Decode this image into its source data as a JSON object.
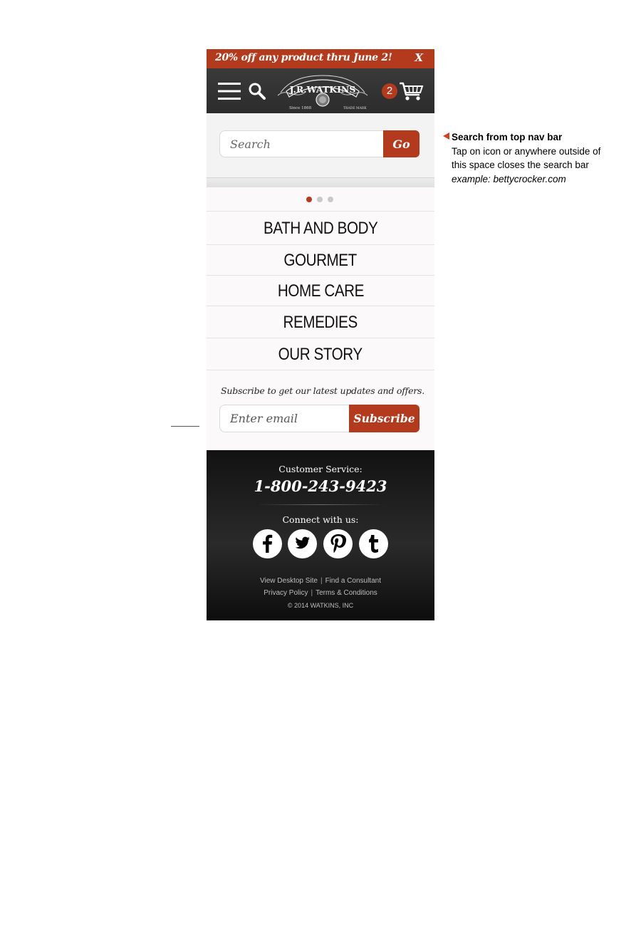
{
  "promo": {
    "text": "20% off any product thru June 2!",
    "close": "X"
  },
  "header": {
    "logo_name": "J.R.WATKINS",
    "logo_since": "Since 1868",
    "logo_trademark": "TRADE MARK",
    "cart_count": "2"
  },
  "search": {
    "placeholder": "Search",
    "button": "Go"
  },
  "carousel": {
    "dots": 3,
    "active_index": 0
  },
  "categories": [
    "BATH AND BODY",
    "GOURMET",
    "HOME CARE",
    "REMEDIES",
    "OUR STORY"
  ],
  "subscribe": {
    "text": "Subscribe to get our latest updates and offers.",
    "placeholder": "Enter email",
    "button": "Subscribe"
  },
  "footer": {
    "cs_label": "Customer Service:",
    "phone": "1-800-243-9423",
    "connect_label": "Connect with us:",
    "social": [
      "facebook",
      "twitter",
      "pinterest",
      "tumblr"
    ],
    "links_row1": [
      "View Desktop Site",
      "Find a Consultant"
    ],
    "links_row2": [
      "Privacy Policy",
      "Terms & Conditions"
    ],
    "separator": "|",
    "copyright": "© 2014 WATKINS, INC"
  },
  "annotation": {
    "title": "Search from top nav bar",
    "line1": "Tap on icon or anywhere outside of",
    "line2": "this space closes the search bar",
    "example": "example: bettycrocker.com"
  },
  "colors": {
    "accent": "#b43a1d",
    "header_bg": "#333333",
    "footer_bg": "#1a1a1a",
    "annotation_arrow": "#d7401d"
  }
}
